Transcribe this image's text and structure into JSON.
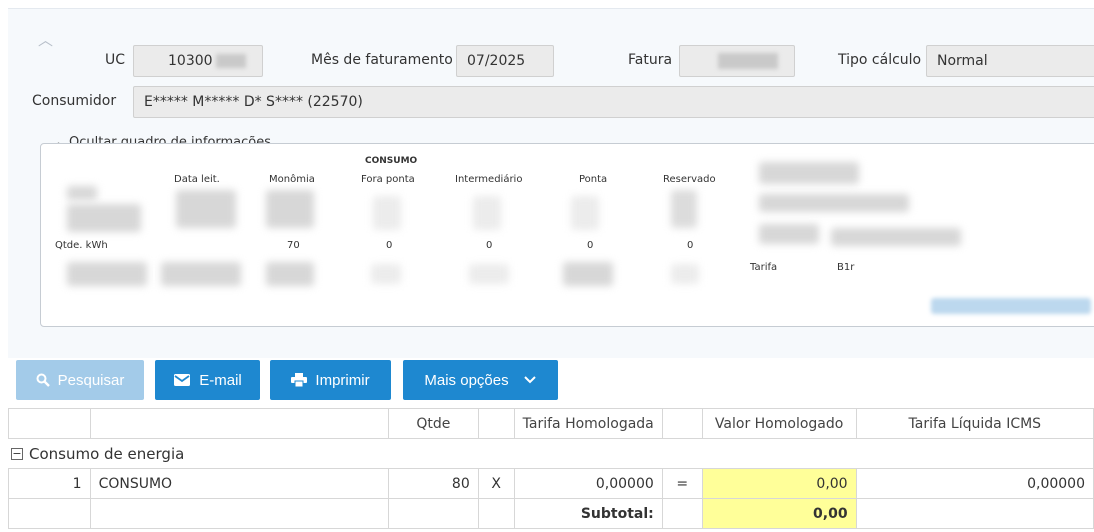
{
  "header": {
    "uc_label": "UC",
    "uc_value": "10300",
    "mes_label": "Mês de faturamento",
    "mes_value": "07/2025",
    "fatura_label": "Fatura",
    "tipo_label": "Tipo cálculo",
    "tipo_value": "Normal",
    "consumidor_label": "Consumidor",
    "consumidor_value": "E***** M***** D* S**** (22570)"
  },
  "info_toggle": "Ocultar quadro de informações",
  "info": {
    "group_title": "CONSUMO",
    "columns": [
      "Data leit.",
      "Monômia",
      "Fora ponta",
      "Intermediário",
      "Ponta",
      "Reservado"
    ],
    "row_label": "Qtde. kWh",
    "row_values": [
      "70",
      "0",
      "0",
      "0",
      "0"
    ],
    "tarifa_label": "Tarifa",
    "tarifa_value": "B1r"
  },
  "toolbar": {
    "pesquisar": "Pesquisar",
    "email": "E-mail",
    "imprimir": "Imprimir",
    "mais": "Mais opções"
  },
  "table": {
    "headers": [
      "Qtde",
      "Tarifa Homologada",
      "Valor Homologado",
      "Tarifa Líquida ICMS"
    ],
    "group": "Consumo de energia",
    "row": {
      "num": "1",
      "desc": "CONSUMO",
      "qtde": "80",
      "x": "X",
      "tarifa": "0,00000",
      "eq": "=",
      "valor": "0,00",
      "liquida": "0,00000"
    },
    "subtotal_label": "Subtotal:",
    "subtotal_value": "0,00"
  },
  "colors": {
    "primary": "#1e88d0",
    "disabled": "#a3cbe9",
    "highlight": "#ffff99"
  }
}
